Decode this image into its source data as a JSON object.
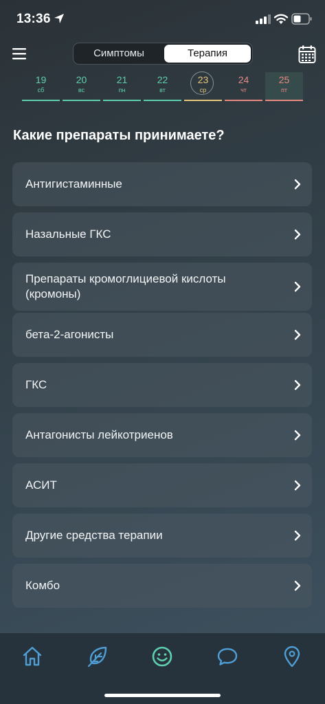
{
  "status_bar": {
    "time": "13:36"
  },
  "header": {
    "segments": [
      "Симптомы",
      "Терапия"
    ],
    "active_segment": 1
  },
  "days": [
    {
      "num": "19",
      "wd": "сб",
      "color": "#5fd0ae"
    },
    {
      "num": "20",
      "wd": "вс",
      "color": "#5fd0ae"
    },
    {
      "num": "21",
      "wd": "пн",
      "color": "#5fd0ae"
    },
    {
      "num": "22",
      "wd": "вт",
      "color": "#5fd0ae"
    },
    {
      "num": "23",
      "wd": "ср",
      "color": "#e9c77a"
    },
    {
      "num": "24",
      "wd": "чт",
      "color": "#e88a82"
    },
    {
      "num": "25",
      "wd": "пт",
      "color": "#e88a82"
    }
  ],
  "main": {
    "title": "Какие препараты принимаете?",
    "items": [
      "Антигистаминные",
      "Назальные ГКС",
      "Препараты кромоглициевой кислоты (кромоны)",
      "бета-2-агонисты",
      "ГКС",
      "Антагонисты лейкотриенов",
      "АСИТ",
      "Другие средства терапии",
      "Комбо"
    ]
  },
  "tabbar": {
    "tabs": [
      "home-icon",
      "leaf-icon",
      "smiley-icon",
      "chat-icon",
      "location-pin-icon"
    ],
    "accent": "#4f9fd6",
    "active_color": "#5fd0ae"
  }
}
